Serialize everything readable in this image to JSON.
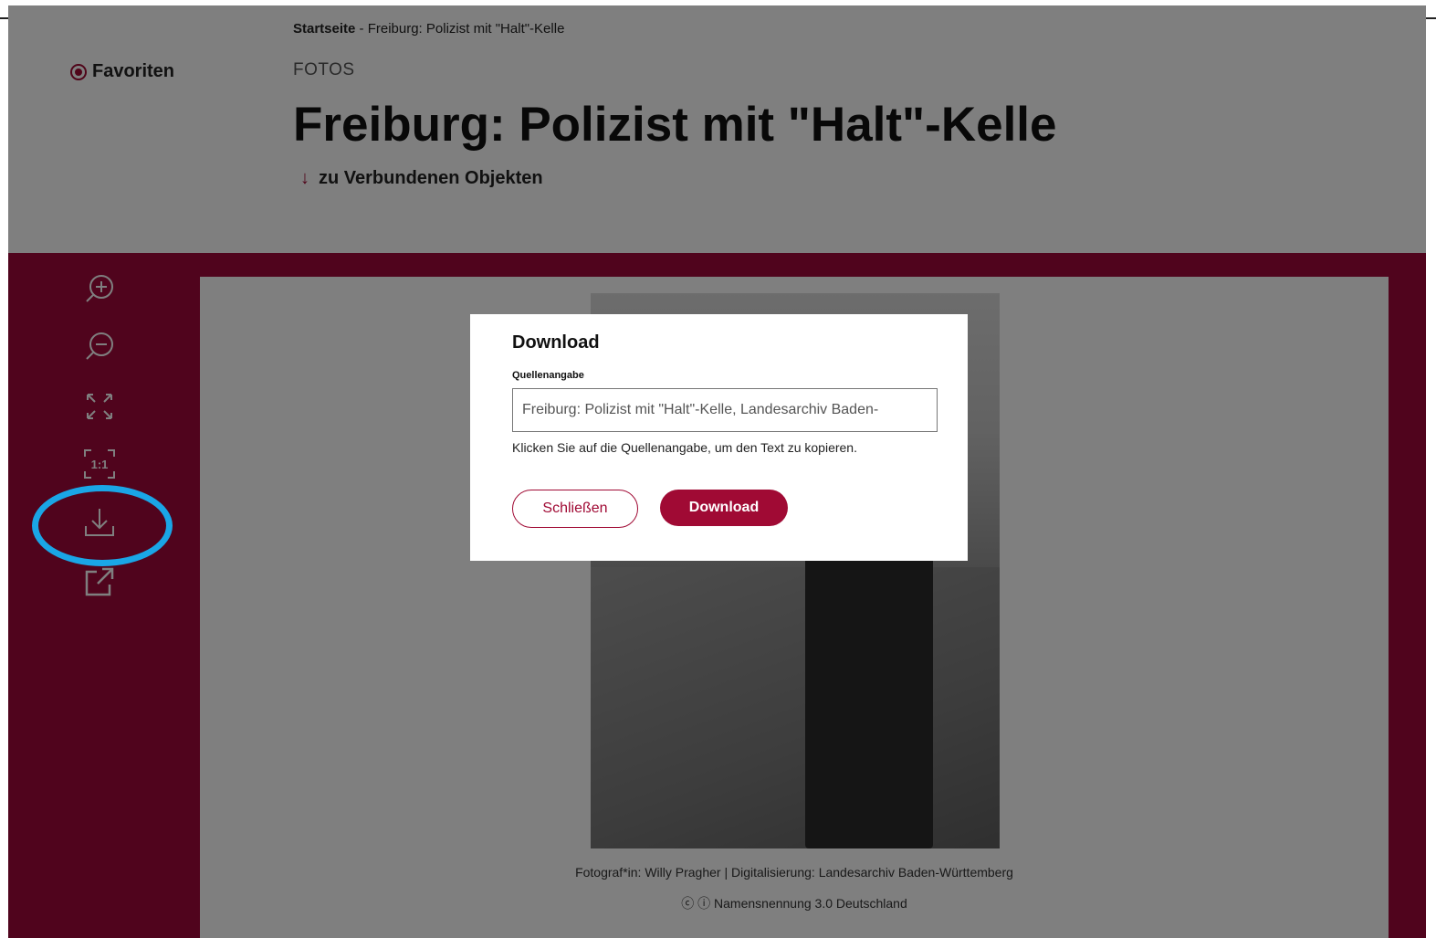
{
  "breadcrumb": {
    "home": "Startseite",
    "current": " - Freiburg: Polizist mit \"Halt\"-Kelle"
  },
  "favorites": {
    "label": "Favoriten"
  },
  "category": "FOTOS",
  "title": "Freiburg: Polizist mit \"Halt\"-Kelle",
  "connected_objects": {
    "arrow": "↓",
    "label": "zu Verbundenen Objekten"
  },
  "toolbar": {
    "icons": [
      "zoom-in-icon",
      "zoom-out-icon",
      "fullscreen-icon",
      "actual-size-icon",
      "download-icon",
      "external-link-icon"
    ],
    "actual_size_label": "1:1"
  },
  "image": {
    "credit": "Fotograf*in: Willy Pragher | Digitalisierung: Landesarchiv Baden-Württemberg",
    "license": "Namensnennung 3.0 Deutschland"
  },
  "modal": {
    "title": "Download",
    "field_label": "Quellenangabe",
    "field_value": "Freiburg: Polizist mit \"Halt\"-Kelle, Landesarchiv Baden-",
    "hint": "Klicken Sie auf die Quellenangabe, um den Text zu kopieren.",
    "close_label": "Schließen",
    "download_label": "Download"
  },
  "colors": {
    "brand": "#a00a34",
    "highlight": "#1aa6e6"
  }
}
